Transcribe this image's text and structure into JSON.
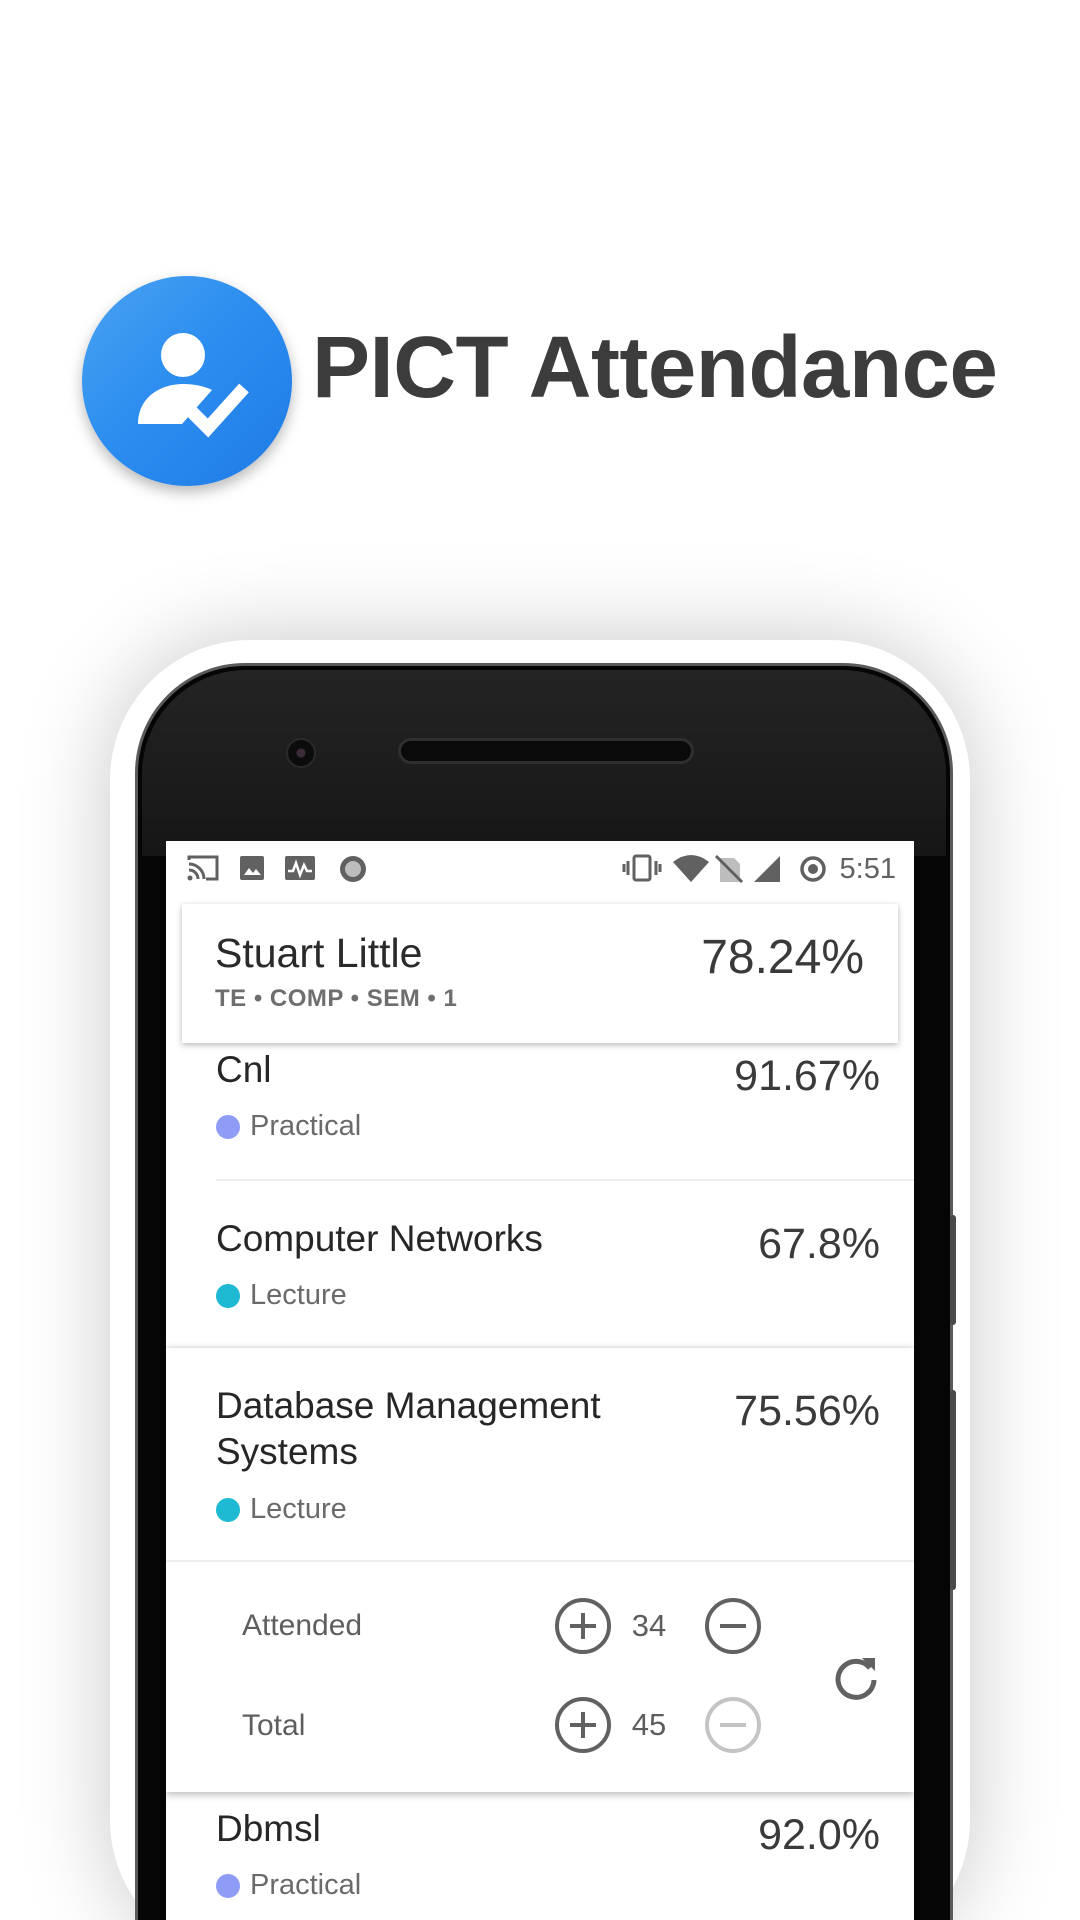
{
  "branding": {
    "app_name": "PICT Attendance",
    "logo_icon": "person-check-icon",
    "logo_color": "#2d8ef0"
  },
  "status_bar": {
    "left_icons": [
      "cast-icon",
      "image-icon",
      "activity-icon",
      "record-icon"
    ],
    "right_icons": [
      "vibrate-icon",
      "wifi-icon",
      "no-sim-icon",
      "signal-icon",
      "sync-icon"
    ],
    "time": "5:51"
  },
  "user": {
    "name": "Stuart Little",
    "meta": "TE • COMP • SEM • 1",
    "percent": "78.24%"
  },
  "subjects": [
    {
      "name": "Cnl",
      "type": "Practical",
      "percent": "91.67%",
      "dot_color": "#8f9cf5"
    },
    {
      "name": "Computer Networks",
      "type": "Lecture",
      "percent": "67.8%",
      "dot_color": "#1eb9d2"
    },
    {
      "name": "Database Management Systems",
      "type": "Lecture",
      "percent": "75.56%",
      "dot_color": "#1eb9d2"
    },
    {
      "name": "Dbmsl",
      "type": "Practical",
      "percent": "92.0%",
      "dot_color": "#8f9cf5"
    }
  ],
  "expanded": {
    "attended_label": "Attended",
    "attended_value": "34",
    "total_label": "Total",
    "total_value": "45"
  }
}
